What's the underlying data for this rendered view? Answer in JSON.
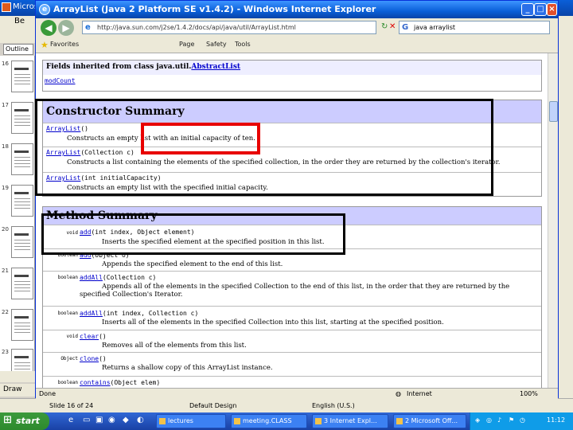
{
  "ppt": {
    "title": "Micros",
    "menu": "Be",
    "outline_tab": "Outline",
    "slide_numbers": [
      "16",
      "17",
      "18",
      "19",
      "20",
      "21",
      "22",
      "23"
    ],
    "draw_label": "Draw",
    "status": {
      "slide": "Slide 16 of 24",
      "design": "Default Design",
      "language": "English (U.S.)"
    }
  },
  "ie": {
    "title": "ArrayList (Java 2 Platform SE v1.4.2) - Windows Internet Explorer",
    "url": "http://java.sun.com/j2se/1.4.2/docs/api/java/util/ArrayList.html",
    "search_value": "java arraylist",
    "favorites": "Favorites",
    "page_menu": "Page",
    "safety_menu": "Safety",
    "tools_menu": "Tools",
    "status_text": "Done",
    "zone": "Internet",
    "zoom": "100%"
  },
  "page": {
    "fields_header": "Fields inherited from class java.util.",
    "fields_header_link": "AbstractList",
    "fields_value": "modCount",
    "constructor_header": "Constructor Summary",
    "constructors": [
      {
        "name": "ArrayList",
        "params": "()",
        "desc": "Constructs an empty list with an initial capacity of ten."
      },
      {
        "name": "ArrayList",
        "params": "(Collection c)",
        "desc": "Constructs a list containing the elements of the specified collection, in the order they are returned by the collection's iterator."
      },
      {
        "name": "ArrayList",
        "params": "(int initialCapacity)",
        "desc": "Constructs an empty list with the specified initial capacity."
      }
    ],
    "method_header": "Method Summary",
    "methods": [
      {
        "mod": "void",
        "name": "add",
        "params": "(int index, Object element)",
        "desc": "Inserts the specified element at the specified position in this list."
      },
      {
        "mod": "boolean",
        "name": "add",
        "params": "(Object o)",
        "desc": "Appends the specified element to the end of this list."
      },
      {
        "mod": "boolean",
        "name": "addAll",
        "params": "(Collection c)",
        "desc": "Appends all of the elements in the specified Collection to the end of this list, in the order that they are returned by the specified Collection's Iterator."
      },
      {
        "mod": "boolean",
        "name": "addAll",
        "params": "(int index, Collection c)",
        "desc": "Inserts all of the elements in the specified Collection into this list, starting at the specified position."
      },
      {
        "mod": "void",
        "name": "clear",
        "params": "()",
        "desc": "Removes all of the elements from this list."
      },
      {
        "mod": "Object",
        "name": "clone",
        "params": "()",
        "desc": "Returns a shallow copy of this ArrayList instance."
      },
      {
        "mod": "boolean",
        "name": "contains",
        "params": "(Object elem)",
        "desc": ""
      }
    ]
  },
  "taskbar": {
    "start": "start",
    "tasks": [
      "lectures",
      "meeting.CLASS",
      "3 Internet Expl...",
      "2 Microsoft Off..."
    ],
    "clock": "11:12"
  },
  "colors": {
    "highlight_box": "#e80000",
    "section_header": "#ccccff",
    "link": "#0000cc"
  }
}
